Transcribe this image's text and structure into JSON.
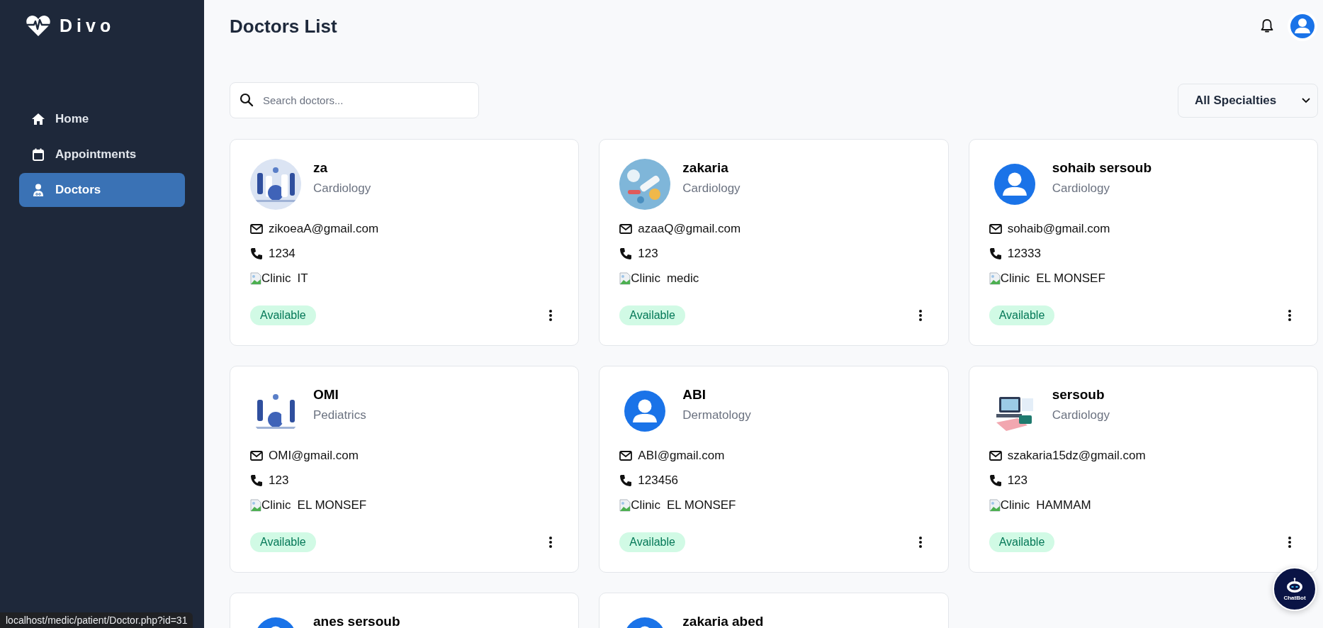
{
  "brand": {
    "name": "Divo"
  },
  "sidebar": {
    "items": [
      {
        "label": "Home",
        "selected": false
      },
      {
        "label": "Appointments",
        "selected": false
      },
      {
        "label": "Doctors",
        "selected": true
      }
    ]
  },
  "header": {
    "title": "Doctors List"
  },
  "search": {
    "placeholder": "Search doctors..."
  },
  "filter": {
    "value": "All Specialties"
  },
  "doctors": [
    {
      "name": "za",
      "specialty": "Cardiology",
      "email": "zikoeaA@gmail.com",
      "phone": "1234",
      "clinic_label": "Clinic",
      "clinic": "IT",
      "status": "Available",
      "kind": "picture"
    },
    {
      "name": "zakaria",
      "specialty": "Cardiology",
      "email": "azaaQ@gmail.com",
      "phone": "123",
      "clinic_label": "Clinic",
      "clinic": "medic",
      "status": "Available",
      "kind": "picture"
    },
    {
      "name": "sohaib sersoub",
      "specialty": "Cardiology",
      "email": "sohaib@gmail.com",
      "phone": "12333",
      "clinic_label": "Clinic",
      "clinic": "EL MONSEF",
      "status": "Available",
      "kind": "default"
    },
    {
      "name": "OMI",
      "specialty": "Pediatrics",
      "email": "OMI@gmail.com",
      "phone": "123",
      "clinic_label": "Clinic",
      "clinic": "EL MONSEF",
      "status": "Available",
      "kind": "picture"
    },
    {
      "name": "ABI",
      "specialty": "Dermatology",
      "email": "ABI@gmail.com",
      "phone": "123456",
      "clinic_label": "Clinic",
      "clinic": "EL MONSEF",
      "status": "Available",
      "kind": "default"
    },
    {
      "name": "sersoub",
      "specialty": "Cardiology",
      "email": "szakaria15dz@gmail.com",
      "phone": "123",
      "clinic_label": "Clinic",
      "clinic": "HAMMAM",
      "status": "Available",
      "kind": "picture"
    },
    {
      "name": "anes sersoub",
      "kind": "default"
    },
    {
      "name": "zakaria abed",
      "kind": "default"
    }
  ],
  "chatbot": {
    "label": "ChatBot"
  },
  "status_bar": {
    "url": "localhost/medic/patient/Doctor.php?id=31"
  }
}
